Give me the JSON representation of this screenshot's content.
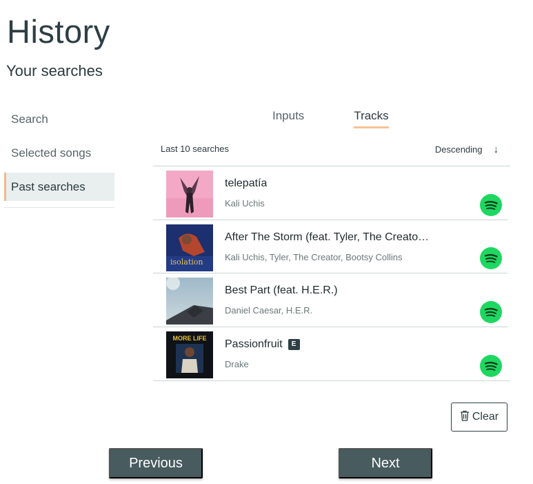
{
  "page": {
    "title": "History",
    "subtitle": "Your searches"
  },
  "sidebar": {
    "items": [
      {
        "label": "Search",
        "active": false
      },
      {
        "label": "Selected songs",
        "active": false
      },
      {
        "label": "Past searches",
        "active": true
      }
    ]
  },
  "tabs": [
    {
      "label": "Inputs",
      "active": false
    },
    {
      "label": "Tracks",
      "active": true
    }
  ],
  "list_header": {
    "label": "Last 10 searches",
    "sort_label": "Descending",
    "sort_icon": "arrow-down-icon"
  },
  "tracks": [
    {
      "title": "telepatía",
      "artist": "Kali Uchis",
      "explicit": false,
      "cover_icon": "album-cover-pink"
    },
    {
      "title": "After The Storm (feat. Tyler, The Creato…",
      "artist": "Kali Uchis, Tyler, The Creator, Bootsy Collins",
      "explicit": false,
      "cover_icon": "album-cover-isolation"
    },
    {
      "title": "Best Part (feat. H.E.R.)",
      "artist": "Daniel Caesar, H.E.R.",
      "explicit": false,
      "cover_icon": "album-cover-sky"
    },
    {
      "title": "Passionfruit",
      "artist": "Drake",
      "explicit": true,
      "explicit_label": "E",
      "cover_icon": "album-cover-more-life",
      "cover_text": "MORE LIFE"
    }
  ],
  "actions": {
    "clear_label": "Clear",
    "previous_label": "Previous",
    "next_label": "Next"
  },
  "colors": {
    "accent": "#f5c197",
    "primary": "#485b5e",
    "spotify": "#1ed760"
  }
}
